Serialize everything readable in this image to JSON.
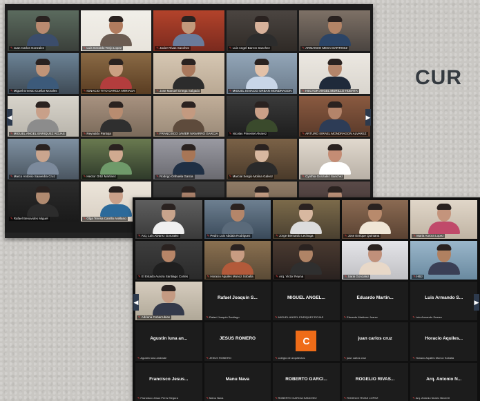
{
  "page": {
    "heading": "CUR"
  },
  "window1": {
    "tiles": [
      {
        "name": "Juan Carlos Gonzalez",
        "bg": "#3a3f3a",
        "wall": "#5b6b5e",
        "skin": "#b98a70",
        "shirt": "#3b4d6b",
        "active": false
      },
      {
        "name": "Luis Gerardo Trejo Lopez",
        "bg": "#e8e4dc",
        "wall": "#f1efe9",
        "skin": "#b07b5e",
        "shirt": "#6b5c52",
        "active": true
      },
      {
        "name": "Javier Rivas Sanchez",
        "bg": "#7a2a1e",
        "wall": "#b3432b",
        "skin": "#c29a7c",
        "shirt": "#6a7b9a",
        "active": false
      },
      {
        "name": "Luis Angel Barron Sanchez",
        "bg": "#2f2a26",
        "wall": "#4b4541",
        "skin": "#d8b29b",
        "shirt": "#2c2c2c",
        "active": false
      },
      {
        "name": "ARMANDO MESA MARTINEZ",
        "bg": "#4a4440",
        "wall": "#7e7166",
        "skin": "#b38466",
        "shirt": "#2b4466",
        "active": false
      },
      {
        "name": "Miguel Ernesto Cuellar Morales",
        "bg": "#3e4a55",
        "wall": "#6c8396",
        "skin": "#c09478",
        "shirt": "#3c5a7a",
        "active": false
      },
      {
        "name": "IGNACIO TITO GARCIA ARRIAGA",
        "bg": "#5a3d22",
        "wall": "#8a6a45",
        "skin": "#caa083",
        "shirt": "#b33d3d",
        "active": false
      },
      {
        "name": "Jose Manuel Ortega Salgado",
        "bg": "#b9a893",
        "wall": "#d6c7b3",
        "skin": "#a9785c",
        "shirt": "#2c2c2c",
        "active": false
      },
      {
        "name": "MIGUEL IGNACIO URBAN MONDRAGON",
        "bg": "#6c7c8c",
        "wall": "#93a6b8",
        "skin": "#e2c1a8",
        "shirt": "#c8d6e8",
        "active": false
      },
      {
        "name": "HECTOR ANGEL MURILLO HUERTA",
        "bg": "#d9d5ce",
        "wall": "#ece8e1",
        "skin": "#b4856a",
        "shirt": "#1f2a3a",
        "active": false
      },
      {
        "name": "MIGUEL ANGEL ENRIQUEZ ROJAS",
        "bg": "#b8b4ab",
        "wall": "#d8d4cb",
        "skin": "#c8a089",
        "shirt": "#8c8c8c",
        "active": false
      },
      {
        "name": "Reynaldo Pantoja",
        "bg": "#7a6a5a",
        "wall": "#a89280",
        "skin": "#b88c70",
        "shirt": "#2f2f2f",
        "active": false
      },
      {
        "name": "FRANCISCO JAVIER NAVARRO GARCIA",
        "bg": "#9a8a78",
        "wall": "#c1ae99",
        "skin": "#c49a80",
        "shirt": "#5e4b3c",
        "active": false
      },
      {
        "name": "Nicolas Pimentel Alvarez",
        "bg": "#1e1e1e",
        "wall": "#3a3a3a",
        "skin": "#caa088",
        "shirt": "#3a4a2c",
        "active": false
      },
      {
        "name": "ARTURO ISRAEL MONDRAGON ALVAREZ",
        "bg": "#5a3a2a",
        "wall": "#8a5a40",
        "skin": "#b4846a",
        "shirt": "#2d3c56",
        "active": false
      },
      {
        "name": "Marco Antonio Saavedra Cruz",
        "bg": "#4a5560",
        "wall": "#7f91a2",
        "skin": "#caa58e",
        "shirt": "#7c8a9c",
        "active": false
      },
      {
        "name": "Hector Ortiz Martinez",
        "bg": "#2f3a2a",
        "wall": "#6a7a50",
        "skin": "#d0aa90",
        "shirt": "#6f9a6a",
        "active": false
      },
      {
        "name": "Rodrigo Orihuela Garcia",
        "bg": "#6a6a70",
        "wall": "#9a9aa2",
        "skin": "#a87656",
        "shirt": "#1f2f44",
        "active": false
      },
      {
        "name": "Marcial Sergio Molina Galvez",
        "bg": "#4a3a2a",
        "wall": "#7b6247",
        "skin": "#d8b8a0",
        "shirt": "#2a2a2a",
        "active": false
      },
      {
        "name": "Cynthia Gonzalez Sanchez",
        "bg": "#b8b0a6",
        "wall": "#e1d9ce",
        "skin": "#c48c74",
        "shirt": "#ffffff",
        "active": false
      },
      {
        "name": "Rafael Benavides Miguel",
        "bg": "#1a1a1a",
        "wall": "#2c2c2c",
        "skin": "#b08a70",
        "shirt": "#2c2c2c",
        "active": false
      },
      {
        "name": "Olga Teresa Carrillo Arellano",
        "bg": "#d9d0c4",
        "wall": "#ece5da",
        "skin": "#caa089",
        "shirt": "#2c6a9a",
        "active": false
      },
      {
        "name": "",
        "bg": "#2a2a2a",
        "wall": "#3a3a3a",
        "skin": "#a8806a",
        "shirt": "#333",
        "active": false
      },
      {
        "name": "",
        "bg": "#6a5a4a",
        "wall": "#8f7b66",
        "skin": "#c09a80",
        "shirt": "#444",
        "active": false
      },
      {
        "name": "",
        "bg": "#3a3030",
        "wall": "#5a4a48",
        "skin": "#b88e76",
        "shirt": "#383838",
        "active": false
      }
    ]
  },
  "window2": {
    "video_tiles": [
      {
        "name": "Arq. Luis Alvarez Gonzalez",
        "bg": "#3a3a3a",
        "wall": "#5e5e5e",
        "skin": "#c8a48c",
        "shirt": "#efefef"
      },
      {
        "name": "Pedro Luis Abdala Rodriguez",
        "bg": "#3a4a5a",
        "wall": "#6d7f90",
        "skin": "#b4866a",
        "shirt": "#5a6a7a"
      },
      {
        "name": "Jorge Bernardo Lechuga",
        "bg": "#4a4030",
        "wall": "#7b6a4a",
        "skin": "#d8b8a0",
        "shirt": "#dcdcdc"
      },
      {
        "name": "Jose Enrique Quintana",
        "bg": "#5a4232",
        "wall": "#8a6a52",
        "skin": "#b88a6c",
        "shirt": "#f0e6d6"
      },
      {
        "name": "Maria Aurora Lopez",
        "bg": "#c0b4a4",
        "wall": "#e0d6c8",
        "skin": "#c4947c",
        "shirt": "#c04a6a"
      },
      {
        "name": "El Estado Aurora Santiago Cortes",
        "bg": "#2a2a2a",
        "wall": "#3e3e3e",
        "skin": "#b88668",
        "shirt": "#1f1f1f"
      },
      {
        "name": "Horacio Aquiles Munoz Soballa",
        "bg": "#5a4a36",
        "wall": "#8a7050",
        "skin": "#c89c82",
        "shirt": "#b35a3a"
      },
      {
        "name": "Arq. Victor Reyna",
        "bg": "#2a2220",
        "wall": "#4a3a30",
        "skin": "#b08466",
        "shirt": "#2f2f2f"
      },
      {
        "name": "Sarai Gonzalez",
        "bg": "#c0c0c4",
        "wall": "#e4e4e8",
        "skin": "#c0907a",
        "shirt": "#e8d8c8"
      },
      {
        "name": "HBJ",
        "bg": "#6a8aa0",
        "wall": "#9ab6ca",
        "skin": "#b08060",
        "shirt": "#3a3f55"
      },
      {
        "name": "Adriana Cobarrubias",
        "bg": "#b0a898",
        "wall": "#d6ccbe",
        "skin": "#c49a82",
        "shirt": "#33394a"
      }
    ],
    "name_tiles": [
      {
        "display": "Rafael Joaquin S...",
        "tag": "Rafael Joaquin Santiago"
      },
      {
        "display": "MIGUEL ANGEL...",
        "tag": "MIGUEL ANGEL ENRIQUEZ ROJAS"
      },
      {
        "display": "Eduardo Martin...",
        "tag": "Eduardo Martinez Juarez"
      },
      {
        "display": "Luis Armando S...",
        "tag": "Luis Armando Suarez"
      },
      {
        "display": "Agustin luna an...",
        "tag": "Agustin luna andrade"
      },
      {
        "display": "JESUS ROMERO",
        "tag": "JESUS ROMERO"
      },
      {
        "display": "C",
        "tag": "colegio de arquitectos",
        "initial": true
      },
      {
        "display": "juan carlos cruz",
        "tag": "juan carlos cruz"
      },
      {
        "display": "Horacio Aquiles...",
        "tag": "Horacio Aquiles Munoz Soballa"
      },
      {
        "display": "Francisco Jesus...",
        "tag": "Francisco Jesus Perez Segura"
      },
      {
        "display": "Manu Nava",
        "tag": "Manu Nava"
      },
      {
        "display": "ROBERTO GARCI...",
        "tag": "ROBERTO GARCIA SANCHEZ"
      },
      {
        "display": "ROGELIO RIVAS...",
        "tag": "ROGELIO RIVAS LOPEZ"
      },
      {
        "display": "Arq. Antonio N...",
        "tag": "Arq. Antonio Nunez Becerril"
      }
    ],
    "initial_color": "#ef6c18"
  },
  "icons": {
    "prev_page": "chevron-left-icon",
    "next_page": "chevron-right-icon",
    "muted_mic": "mic-muted-icon"
  },
  "arrows": {
    "left": "◀",
    "right": "▶"
  },
  "mic_glyph": "✎"
}
